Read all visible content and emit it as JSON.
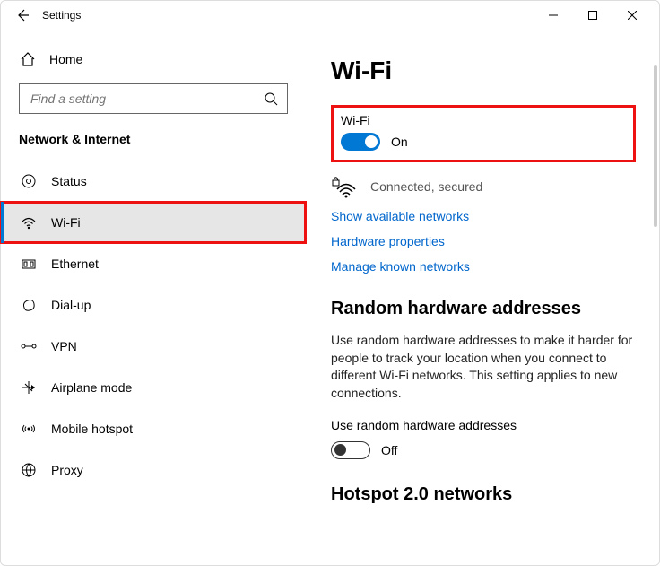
{
  "titlebar": {
    "app_name": "Settings"
  },
  "sidebar": {
    "home_label": "Home",
    "search_placeholder": "Find a setting",
    "section_title": "Network & Internet",
    "items": [
      {
        "label": "Status",
        "icon": "status-icon"
      },
      {
        "label": "Wi-Fi",
        "icon": "wifi-icon"
      },
      {
        "label": "Ethernet",
        "icon": "ethernet-icon"
      },
      {
        "label": "Dial-up",
        "icon": "dialup-icon"
      },
      {
        "label": "VPN",
        "icon": "vpn-icon"
      },
      {
        "label": "Airplane mode",
        "icon": "airplane-icon"
      },
      {
        "label": "Mobile hotspot",
        "icon": "hotspot-icon"
      },
      {
        "label": "Proxy",
        "icon": "proxy-icon"
      }
    ]
  },
  "main": {
    "page_title": "Wi-Fi",
    "wifi_toggle": {
      "label": "Wi-Fi",
      "state_text": "On",
      "on": true
    },
    "connection_status": "Connected, secured",
    "links": {
      "show_networks": "Show available networks",
      "hw_props": "Hardware properties",
      "known_networks": "Manage known networks"
    },
    "random_hw": {
      "heading": "Random hardware addresses",
      "body": "Use random hardware addresses to make it harder for people to track your location when you connect to different Wi-Fi networks. This setting applies to new connections.",
      "toggle_label": "Use random hardware addresses",
      "state_text": "Off"
    },
    "hotspot2": {
      "heading": "Hotspot 2.0 networks"
    }
  }
}
